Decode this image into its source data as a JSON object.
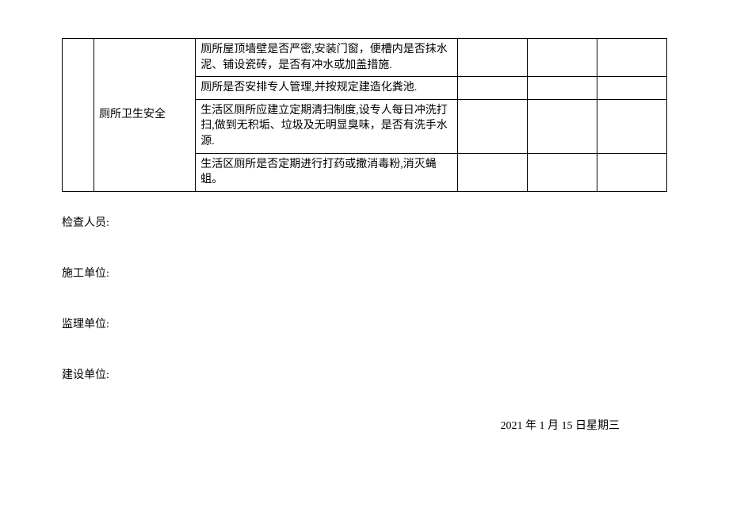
{
  "table": {
    "category": "厕所卫生安全",
    "rows": [
      "厕所屋顶墙壁是否严密,安装门窗，便槽内是否抹水泥、铺设瓷砖，是否有冲水或加盖措施.",
      "厕所是否安排专人管理,并按规定建造化粪池.",
      "生活区厕所应建立定期清扫制度,设专人每日冲洗打扫,做到无积垢、垃圾及无明显臭味，是否有洗手水源.",
      "生活区厕所是否定期进行打药或撒消毒粉,消灭蝇蛆。"
    ]
  },
  "labels": {
    "inspector": "检查人员:",
    "construction": "施工单位:",
    "supervision": "监理单位:",
    "owner": "建设单位:"
  },
  "date": "2021 年 1 月 15 日星期三"
}
